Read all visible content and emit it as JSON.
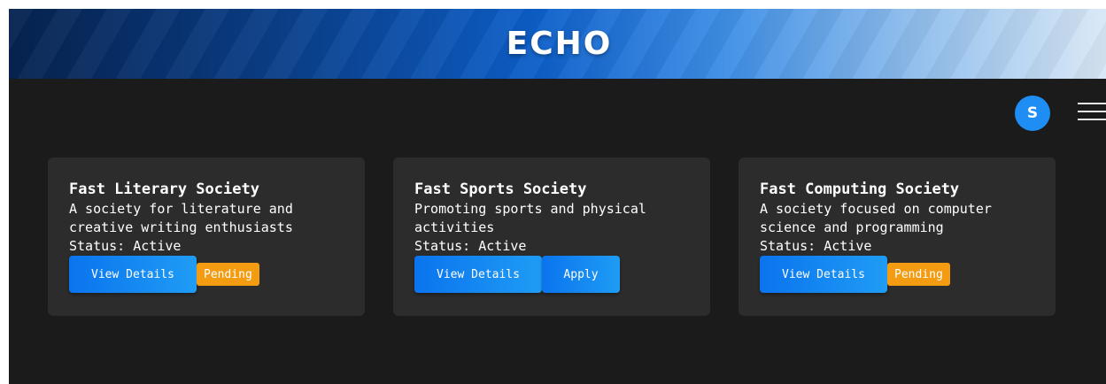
{
  "app": {
    "logo": "ECHO"
  },
  "user": {
    "avatar_initial": "S"
  },
  "societies": [
    {
      "title": "Fast Literary Society",
      "description": "A society for literature and creative writing enthusiasts",
      "status": "Status: Active",
      "view_label": "View Details",
      "action_type": "badge",
      "action_label": "Pending"
    },
    {
      "title": "Fast Sports Society",
      "description": "Promoting sports and physical activities",
      "status": "Status: Active",
      "view_label": "View Details",
      "action_type": "button",
      "action_label": "Apply"
    },
    {
      "title": "Fast Computing Society",
      "description": "A society focused on computer science and programming",
      "status": "Status: Active",
      "view_label": "View Details",
      "action_type": "badge",
      "action_label": "Pending"
    }
  ],
  "colors": {
    "background": "#1b1b1b",
    "card": "#2c2c2c",
    "primary": "#1e8ef5",
    "pending": "#f39c12"
  },
  "icons": {
    "menu": "hamburger-menu-icon"
  }
}
